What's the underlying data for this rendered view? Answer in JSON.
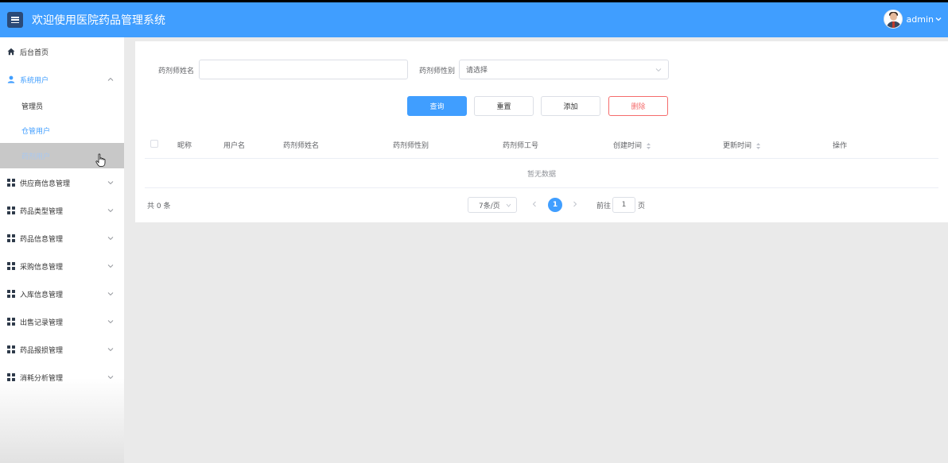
{
  "header": {
    "title": "欢迎使用医院药品管理系统",
    "user_name": "admin",
    "brand_color": "#409eff"
  },
  "sidebar": {
    "items": [
      {
        "label": "后台首页",
        "icon": "home-icon"
      },
      {
        "label": "系统用户",
        "icon": "user-icon",
        "expanded": true
      },
      {
        "label": "管理员"
      },
      {
        "label": "仓管用户"
      },
      {
        "label": "药剂用户",
        "active": true
      },
      {
        "label": "供应商信息管理",
        "icon": "grid-icon"
      },
      {
        "label": "药品类型管理",
        "icon": "grid-icon"
      },
      {
        "label": "药品信息管理",
        "icon": "grid-icon"
      },
      {
        "label": "采购信息管理",
        "icon": "grid-icon"
      },
      {
        "label": "入库信息管理",
        "icon": "grid-icon"
      },
      {
        "label": "出售记录管理",
        "icon": "grid-icon"
      },
      {
        "label": "药品报损管理",
        "icon": "grid-icon"
      },
      {
        "label": "消耗分析管理",
        "icon": "grid-icon"
      }
    ]
  },
  "search": {
    "name_label": "药剂师姓名",
    "name_value": "",
    "gender_label": "药剂师性别",
    "gender_placeholder": "请选择"
  },
  "actions": {
    "query": "查询",
    "reset": "重置",
    "add": "添加",
    "delete": "删除"
  },
  "table": {
    "columns": [
      "昵称",
      "用户名",
      "药剂师姓名",
      "药剂师性别",
      "药剂师工号",
      "创建时间",
      "更新时间",
      "操作"
    ],
    "empty_text": "暂无数据"
  },
  "pagination": {
    "total_text": "共 0 条",
    "page_size": "7条/页",
    "current_page": "1",
    "goto_prefix": "前往",
    "goto_value": "1",
    "goto_suffix": "页"
  }
}
